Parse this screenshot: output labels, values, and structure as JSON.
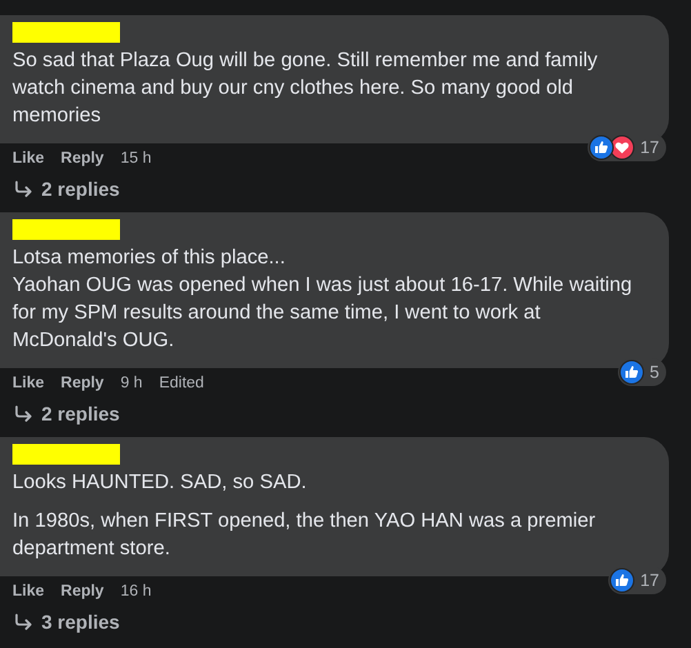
{
  "comments": [
    {
      "paragraphs": [
        "So sad that Plaza Oug will be gone. Still remember me and family watch cinema and buy our cny clothes here. So many good old memories"
      ],
      "reactions": [
        {
          "kind": "like"
        },
        {
          "kind": "love"
        }
      ],
      "reaction_count": "17",
      "actions": [
        "Like",
        "Reply"
      ],
      "time": "15 h",
      "replies": "2 replies"
    },
    {
      "paragraphs": [
        "Lotsa memories of this place...\nYaohan OUG was opened when I was just about 16-17. While waiting for my SPM results around the same time, I went to work at McDonald's OUG."
      ],
      "reactions": [
        {
          "kind": "like"
        }
      ],
      "reaction_count": "5",
      "actions": [
        "Like",
        "Reply"
      ],
      "time": "9 h",
      "edited": "Edited",
      "replies": "2 replies"
    },
    {
      "paragraphs": [
        "Looks HAUNTED. SAD, so SAD.",
        "In 1980s, when FIRST opened, the then YAO HAN was a premier department store."
      ],
      "reactions": [
        {
          "kind": "like"
        }
      ],
      "reaction_count": "17",
      "actions": [
        "Like",
        "Reply"
      ],
      "time": "16 h",
      "replies": "3 replies"
    }
  ]
}
